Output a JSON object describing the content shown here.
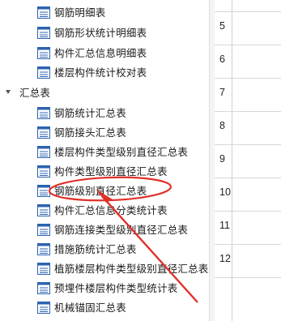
{
  "tree": {
    "items": [
      {
        "label": "钢筋明细表",
        "type": "table"
      },
      {
        "label": "钢筋形状统计明细表",
        "type": "table"
      },
      {
        "label": "构件汇总信息明细表",
        "type": "table"
      },
      {
        "label": "楼层构件统计校对表",
        "type": "table"
      }
    ],
    "category": {
      "label": "汇总表",
      "expanded": true
    },
    "summary_items": [
      {
        "label": "钢筋统计汇总表"
      },
      {
        "label": "钢筋接头汇总表"
      },
      {
        "label": "楼层构件类型级别直径汇总表"
      },
      {
        "label": "构件类型级别直径汇总表"
      },
      {
        "label": "钢筋级别直径汇总表",
        "highlighted": true
      },
      {
        "label": "构件汇总信息分类统计表"
      },
      {
        "label": "钢筋连接类型级别直径汇总表"
      },
      {
        "label": "措施筋统计汇总表"
      },
      {
        "label": "植筋楼层构件类型级别直径汇总表"
      },
      {
        "label": "预埋件楼层构件类型统计表"
      },
      {
        "label": "机械锚固汇总表"
      }
    ]
  },
  "grid": {
    "row_numbers": [
      "5",
      "6",
      "7",
      "8",
      "9",
      "10",
      "11",
      "12"
    ]
  },
  "colors": {
    "icon_blue": "#2b63b0",
    "annotation_red": "#e0302a"
  },
  "icons": {
    "table": "table-doc-icon",
    "caret": "expand-caret-icon"
  }
}
